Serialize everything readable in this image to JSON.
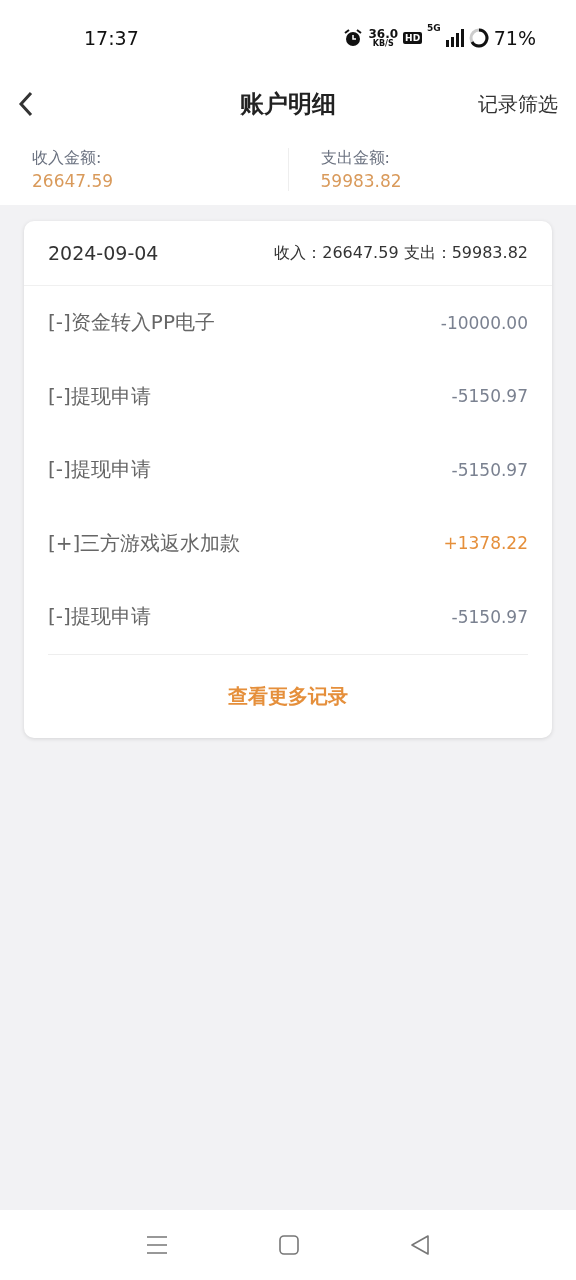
{
  "status_bar": {
    "time": "17:37",
    "speed": "36.0",
    "speed_unit": "KB/S",
    "hd": "HD",
    "network": "5G",
    "battery": "71%"
  },
  "header": {
    "title": "账户明细",
    "action": "记录筛选"
  },
  "summary": [
    {
      "label": "收入金额:",
      "amount": "26647.59"
    },
    {
      "label": "支出金额:",
      "amount": "59983.82"
    }
  ],
  "card": {
    "date": "2024-09-04",
    "totals": "收入：26647.59 支出：59983.82",
    "rows": [
      {
        "kind": "expense",
        "title": "[-]资金转入PP电子",
        "amount": "-10000.00"
      },
      {
        "kind": "expense",
        "title": "[-]提现申请",
        "amount": "-5150.97"
      },
      {
        "kind": "expense",
        "title": "[-]提现申请",
        "amount": "-5150.97"
      },
      {
        "kind": "income",
        "title": "[+]三方游戏返水加款",
        "amount": "+1378.22"
      },
      {
        "kind": "expense",
        "title": "[-]提现申请",
        "amount": "-5150.97"
      }
    ],
    "more": "查看更多记录"
  }
}
